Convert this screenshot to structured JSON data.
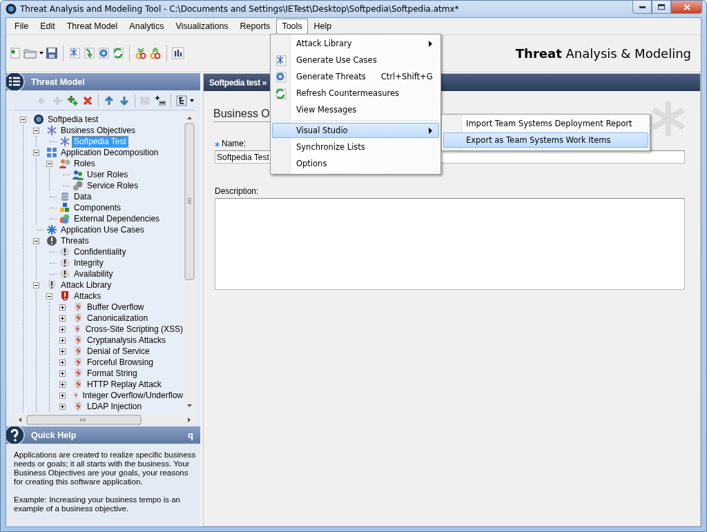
{
  "window": {
    "title": "Threat Analysis and Modeling Tool - C:\\Documents and Settings\\IETest\\Desktop\\Softpedia\\Softpedia.atmx*"
  },
  "menubar": [
    {
      "label": "File",
      "selected": false
    },
    {
      "label": "Edit",
      "selected": false
    },
    {
      "label": "Threat Model",
      "selected": false
    },
    {
      "label": "Analytics",
      "selected": false
    },
    {
      "label": "Visualizations",
      "selected": false
    },
    {
      "label": "Reports",
      "selected": false
    },
    {
      "label": "Tools",
      "selected": true
    },
    {
      "label": "Help",
      "selected": false
    }
  ],
  "brand": "**Threat** Analysis & Modeling",
  "tools_menu": [
    {
      "label": "Attack Library",
      "kind": "plain",
      "submenu": true,
      "selected": false
    },
    {
      "label": "Generate Use Cases",
      "kind": "use-cases",
      "submenu": false,
      "selected": false
    },
    {
      "label": "Generate Threats",
      "kind": "threats",
      "shortcut": "Ctrl+Shift+G",
      "submenu": false,
      "selected": false
    },
    {
      "label": "Refresh Countermeasures",
      "kind": "refresh",
      "submenu": false,
      "selected": false
    },
    {
      "label": "View Messages",
      "kind": "plain",
      "submenu": false,
      "selected": false
    },
    {
      "label": "Visual Studio",
      "kind": "plain",
      "submenu": true,
      "selected": true,
      "separator_before": true
    },
    {
      "label": "Synchronize Lists",
      "kind": "plain",
      "submenu": false,
      "selected": false
    },
    {
      "label": "Options",
      "kind": "plain",
      "submenu": false,
      "selected": false
    }
  ],
  "submenu": [
    {
      "label": "Import Team Systems Deployment Report",
      "selected": false
    },
    {
      "label": "Export as Team Systems Work Items",
      "selected": true
    }
  ],
  "left_panel": {
    "title": "Threat Model",
    "tree_toolbar": [
      {
        "kind": "back",
        "disabled": true
      },
      {
        "kind": "add",
        "disabled": true
      },
      {
        "kind": "add-child",
        "disabled": false
      },
      {
        "kind": "delete",
        "disabled": false
      },
      {
        "kind": "up",
        "disabled": false,
        "separator_before": true
      },
      {
        "kind": "down",
        "disabled": false
      },
      {
        "kind": "sort",
        "disabled": true,
        "separator_before": true
      },
      {
        "kind": "expand",
        "disabled": false
      },
      {
        "kind": "view",
        "disabled": false,
        "separator_before": true
      }
    ],
    "tree": [
      {
        "label": "Softpedia test",
        "kind": "root",
        "expanded": true,
        "selected": false,
        "children": [
          {
            "label": "Business Objectives",
            "kind": "objective",
            "expanded": true,
            "selected": false,
            "children": [
              {
                "label": "Softpedia Test",
                "kind": "objective",
                "selected": true
              }
            ]
          },
          {
            "label": "Application Decomposition",
            "kind": "decomposition",
            "expanded": true,
            "selected": false,
            "children": [
              {
                "label": "Roles",
                "kind": "roles",
                "expanded": true,
                "selected": false,
                "children": [
                  {
                    "label": "User Roles",
                    "kind": "user-roles",
                    "selected": false
                  },
                  {
                    "label": "Service Roles",
                    "kind": "service-roles",
                    "selected": false
                  }
                ]
              },
              {
                "label": "Data",
                "kind": "data",
                "selected": false
              },
              {
                "label": "Components",
                "kind": "components",
                "selected": false
              },
              {
                "label": "External Dependencies",
                "kind": "dependencies",
                "selected": false
              }
            ]
          },
          {
            "label": "Application Use Cases",
            "kind": "use-cases",
            "selected": false
          },
          {
            "label": "Threats",
            "kind": "threats",
            "expanded": true,
            "selected": false,
            "children": [
              {
                "label": "Confidentiality",
                "kind": "threat",
                "selected": false
              },
              {
                "label": "Integrity",
                "kind": "threat",
                "selected": false
              },
              {
                "label": "Availability",
                "kind": "threat",
                "selected": false
              }
            ]
          },
          {
            "label": "Attack Library",
            "kind": "attack-library",
            "expanded": true,
            "selected": false,
            "children": [
              {
                "label": "Attacks",
                "kind": "attacks",
                "expanded": true,
                "selected": false,
                "children": [
                  {
                    "label": "Buffer Overflow",
                    "kind": "attack",
                    "expanded": false,
                    "selected": false
                  },
                  {
                    "label": "Canonicalization",
                    "kind": "attack",
                    "expanded": false,
                    "selected": false
                  },
                  {
                    "label": "Cross-Site Scripting (XSS)",
                    "kind": "attack",
                    "expanded": false,
                    "selected": false
                  },
                  {
                    "label": "Cryptanalysis Attacks",
                    "kind": "attack",
                    "expanded": false,
                    "selected": false
                  },
                  {
                    "label": "Denial of Service",
                    "kind": "attack",
                    "expanded": false,
                    "selected": false
                  },
                  {
                    "label": "Forceful Browsing",
                    "kind": "attack",
                    "expanded": false,
                    "selected": false
                  },
                  {
                    "label": "Format String",
                    "kind": "attack",
                    "expanded": false,
                    "selected": false
                  },
                  {
                    "label": "HTTP Replay Attack",
                    "kind": "attack",
                    "expanded": false,
                    "selected": false
                  },
                  {
                    "label": "Integer Overflow/Underflow",
                    "kind": "attack",
                    "expanded": false,
                    "selected": false
                  },
                  {
                    "label": "LDAP Injection",
                    "kind": "attack",
                    "expanded": false,
                    "selected": false
                  }
                ]
              }
            ]
          }
        ]
      }
    ]
  },
  "quick_help": {
    "title": "Quick Help",
    "key": "q",
    "paragraphs": [
      "Applications are created to realize specific business needs or goals; it all starts with the business. Your Business Objectives are your goals, your reasons for creating this software application.",
      "Example: Increasing your business tempo is an example of a business objective."
    ]
  },
  "content": {
    "breadcrumb": "Softpedia test »",
    "heading": "Business O",
    "fields": [
      {
        "label": "Name:",
        "required": true,
        "kind": "line",
        "value": "Softpedia Test"
      },
      {
        "label": "Description:",
        "required": false,
        "kind": "area"
      }
    ]
  }
}
